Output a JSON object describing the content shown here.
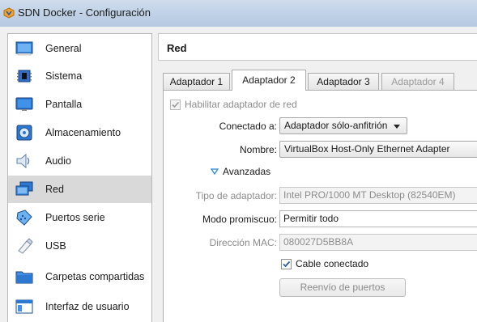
{
  "window": {
    "title": "SDN Docker - Configuración",
    "icon": "virtualbox-icon"
  },
  "sidebar": {
    "items": [
      {
        "label": "General",
        "icon": "general-icon"
      },
      {
        "label": "Sistema",
        "icon": "system-chip-icon"
      },
      {
        "label": "Pantalla",
        "icon": "display-monitor-icon"
      },
      {
        "label": "Almacenamiento",
        "icon": "storage-disk-icon"
      },
      {
        "label": "Audio",
        "icon": "audio-speaker-icon"
      },
      {
        "label": "Red",
        "icon": "network-icon",
        "selected": true
      },
      {
        "label": "Puertos serie",
        "icon": "serial-port-icon"
      },
      {
        "label": "USB",
        "icon": "usb-icon"
      },
      {
        "label": "Carpetas compartidas",
        "icon": "shared-folder-icon"
      },
      {
        "label": "Interfaz de usuario",
        "icon": "user-interface-icon"
      }
    ]
  },
  "main": {
    "title": "Red",
    "tabs": [
      {
        "label": "Adaptador 1",
        "state": "normal"
      },
      {
        "label": "Adaptador 2",
        "state": "active"
      },
      {
        "label": "Adaptador 3",
        "state": "normal"
      },
      {
        "label": "Adaptador 4",
        "state": "disabled"
      }
    ],
    "enable_adapter": {
      "label": "Habilitar adaptador de red",
      "checked": true,
      "disabled": true
    },
    "attached_to": {
      "label": "Conectado a:",
      "value": "Adaptador sólo-anfitrión"
    },
    "name": {
      "label": "Nombre:",
      "value": "VirtualBox Host-Only Ethernet Adapter"
    },
    "advanced": {
      "label": "Avanzadas",
      "icon": "triangle-down-icon"
    },
    "adapter_type": {
      "label": "Tipo de adaptador:",
      "value": "Intel PRO/1000 MT Desktop (82540EM)"
    },
    "promiscuous": {
      "label": "Modo promiscuo:",
      "value": "Permitir todo"
    },
    "mac": {
      "label": "Dirección MAC:",
      "value": "080027D5BB8A"
    },
    "cable": {
      "label": "Cable conectado",
      "checked": true
    },
    "port_forwarding": {
      "label": "Reenvío de puertos"
    }
  },
  "colors": {
    "titlebar": "#c2d3e8",
    "selected_item": "#d9d9d9",
    "advanced_arrow": "#2b8ad8"
  }
}
